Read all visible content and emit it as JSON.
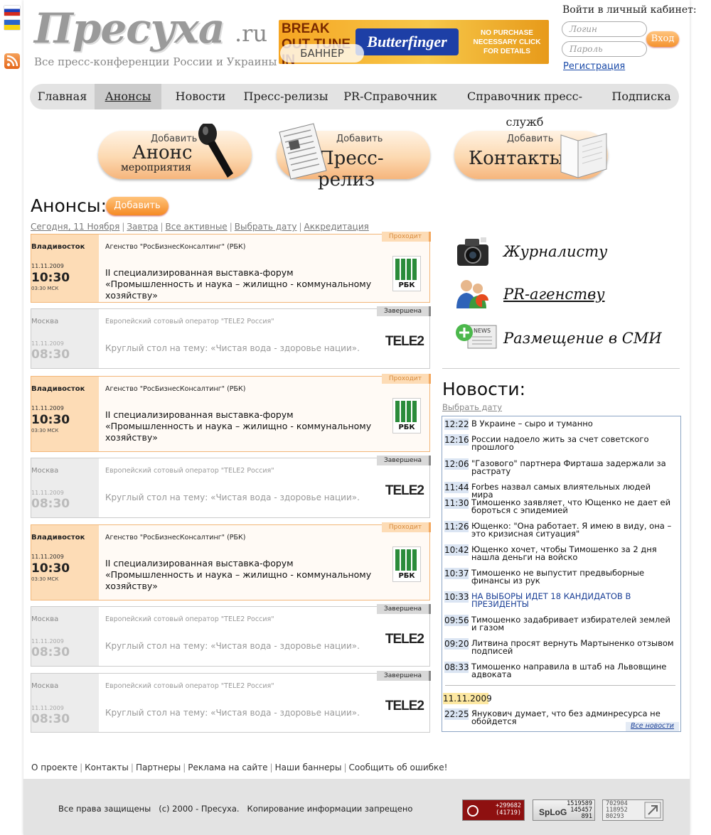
{
  "header": {
    "logo_title": "Пресуха",
    "logo_suffix": ".ru",
    "logo_tagline": "Все пресс-конференции России и Украины",
    "banner": {
      "top_text": "BREAK OUT TUNE IN",
      "brand": "Butterfinger",
      "right_text": "NO PURCHASE NECESSARY CLICK FOR DETAILS",
      "overlay": "БАННЕР"
    },
    "login": {
      "label": "Войти в личный кабинет:",
      "login_placeholder": "Логин",
      "password_placeholder": "Пароль",
      "submit_label": "Вход",
      "register_label": "Регистрация"
    }
  },
  "nav": {
    "items": [
      "Главная",
      "Анонсы",
      "Новости",
      "Пресс-релизы",
      "PR-Справочник",
      "Справочник пресс-служб",
      "Подписка"
    ],
    "active": "Анонсы"
  },
  "add_buttons": [
    {
      "small": "Добавить",
      "large": "Анонс",
      "sub": "мероприятия"
    },
    {
      "small": "Добавить",
      "large": "Пресс-релиз",
      "sub": ""
    },
    {
      "small": "Добавить",
      "large": "Контакты",
      "sub": ""
    }
  ],
  "announcements": {
    "title": "Анонсы:",
    "add_label": "Добавить",
    "filters": [
      "Сегодня, 11 Ноября",
      "Завтра",
      "Все активные",
      "Выбрать дату",
      "Аккредитация"
    ],
    "cards": [
      {
        "state": "active",
        "city": "Владивосток",
        "date": "11.11.2009",
        "time": "10:30",
        "tz": "03:30 МСК",
        "org": "Агенство \"РосБизнесКонсалтинг\" (РБК)",
        "desc": "II специализированная выставка-форум «Промышленность и наука – жилищно - коммунальному хозяйству»",
        "status": "Проходит",
        "logo": "РБК"
      },
      {
        "state": "done",
        "city": "Москва",
        "date": "11.11.2009",
        "time": "08:30",
        "tz": "",
        "org": "Европейский сотовый оператор \"TELE2 Россия\"",
        "desc": "Круглый стол на тему: «Чистая вода - здоровье нации».",
        "status": "Завершена",
        "logo": "TELE2"
      },
      {
        "state": "active",
        "city": "Владивосток",
        "date": "11.11.2009",
        "time": "10:30",
        "tz": "03:30 МСК",
        "org": "Агенство \"РосБизнесКонсалтинг\" (РБК)",
        "desc": "II специализированная выставка-форум «Промышленность и наука – жилищно - коммунальному хозяйству»",
        "status": "Проходит",
        "logo": "РБК"
      },
      {
        "state": "done",
        "city": "Москва",
        "date": "11.11.2009",
        "time": "08:30",
        "tz": "",
        "org": "Европейский сотовый оператор \"TELE2 Россия\"",
        "desc": "Круглый стол на тему: «Чистая вода - здоровье нации».",
        "status": "Завершена",
        "logo": "TELE2"
      },
      {
        "state": "active",
        "city": "Владивосток",
        "date": "11.11.2009",
        "time": "10:30",
        "tz": "03:30 МСК",
        "org": "Агенство \"РосБизнесКонсалтинг\" (РБК)",
        "desc": "II специализированная выставка-форум «Промышленность и наука – жилищно - коммунальному хозяйству»",
        "status": "Проходит",
        "logo": "РБК"
      },
      {
        "state": "done",
        "city": "Москва",
        "date": "11.11.2009",
        "time": "08:30",
        "tz": "",
        "org": "Европейский сотовый оператор \"TELE2 Россия\"",
        "desc": "Круглый стол на тему: «Чистая вода - здоровье нации».",
        "status": "Завершена",
        "logo": "TELE2"
      },
      {
        "state": "done",
        "city": "Москва",
        "date": "11.11.2009",
        "time": "08:30",
        "tz": "",
        "org": "Европейский сотовый оператор \"TELE2 Россия\"",
        "desc": "Круглый стол на тему: «Чистая вода - здоровье нации».",
        "status": "Завершена",
        "logo": "TELE2"
      }
    ]
  },
  "sidebar": {
    "items": [
      {
        "label": "Журналисту",
        "icon": "camera-icon"
      },
      {
        "label": "PR-агенству",
        "icon": "people-icon"
      },
      {
        "label": "Размещение в СМИ",
        "icon": "news-add-icon"
      }
    ]
  },
  "news": {
    "title": "Новости:",
    "pick_date": "Выбрать дату",
    "items": [
      {
        "time": "12:22",
        "text": "В Украине – сыро и туманно",
        "highlight": false
      },
      {
        "time": "12:16",
        "text": "России надоело жить за счет советского прошлого",
        "highlight": false
      },
      {
        "time": "12:06",
        "text": "\"Газового\" партнера Фирташа задержали за растрату",
        "highlight": false
      },
      {
        "time": "11:44",
        "text": "Forbes назвал самых влиятельных людей мира",
        "highlight": false
      },
      {
        "time": "11:30",
        "text": "Тимошенко заявляет, что Ющенко не дает ей бороться с эпидемией",
        "highlight": false
      },
      {
        "time": "11:26",
        "text": "Ющенко: \"Она работает. Я имею в виду, она – это кризисная ситуация\"",
        "highlight": false
      },
      {
        "time": "10:42",
        "text": "Ющенко хочет, чтобы Тимошенко за 2 дня нашла деньги на войско",
        "highlight": false
      },
      {
        "time": "10:37",
        "text": "Тимошенко не выпустит предвыборные финансы из рук",
        "highlight": false
      },
      {
        "time": "10:33",
        "text": "НА ВЫБОРЫ ИДЕТ 18 КАНДИДАТОВ В ПРЕЗИДЕНТЫ",
        "highlight": true
      },
      {
        "time": "09:56",
        "text": "Тимошенко задабривает избирателей землей и газом",
        "highlight": false
      },
      {
        "time": "09:20",
        "text": "Литвина просят вернуть Мартыненко отзывом подписей",
        "highlight": false
      },
      {
        "time": "08:33",
        "text": "Тимошенко направила в штаб на Львовщине адвоката",
        "highlight": false
      }
    ],
    "day_label": "11.11.2009",
    "day_items": [
      {
        "time": "22:25",
        "text": "Янукович думает, что без админресурса не обойдется"
      }
    ],
    "all_news": "Все новости"
  },
  "footer": {
    "links": [
      "О проекте",
      "Контакты",
      "Партнеры",
      "Реклама на сайте",
      "Наши баннеры",
      "Сообщить об ошибке!"
    ],
    "copyright": "Все права защищены   (c) 2000 - Пресуха.   Копирование информации запрещено",
    "counters": [
      {
        "lines": [
          "+299682",
          "(41719)"
        ]
      },
      {
        "lines": [
          "1519589",
          "145457",
          "891"
        ],
        "brand": "SpLoG"
      },
      {
        "lines": [
          "702904",
          "118952",
          "80293"
        ]
      }
    ]
  }
}
